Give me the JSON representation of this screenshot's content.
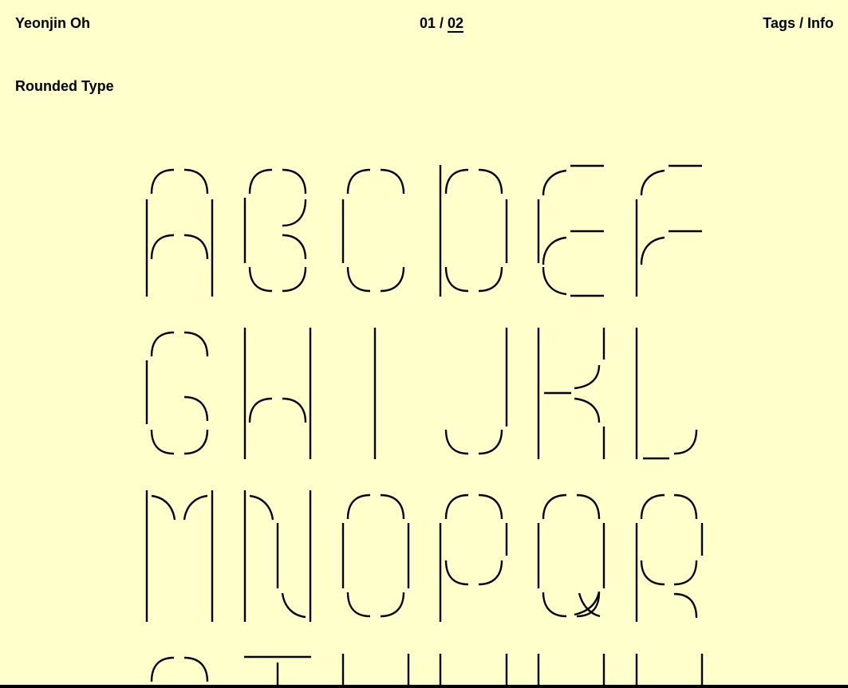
{
  "header": {
    "author": "Yeonjin Oh",
    "page_current": "01",
    "page_separator": " / ",
    "page_total": "02",
    "nav_tags": "Tags",
    "nav_separator": " / ",
    "nav_info": "Info"
  },
  "project": {
    "title": "Rounded Type"
  },
  "specimen": {
    "glyphs": [
      "A",
      "B",
      "C",
      "D",
      "E",
      "F",
      "G",
      "H",
      "I",
      "J",
      "K",
      "L",
      "M",
      "N",
      "O",
      "P",
      "Q",
      "R",
      "S",
      "T",
      "U",
      "V",
      "W"
    ]
  }
}
